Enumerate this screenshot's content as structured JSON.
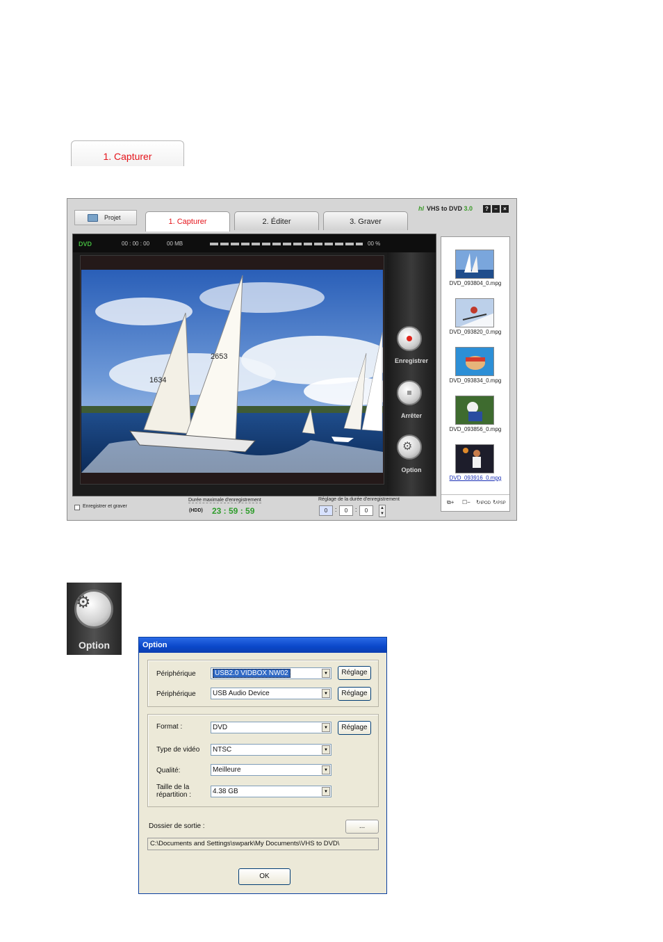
{
  "snippet_tab": {
    "label": "1. Capturer"
  },
  "app": {
    "project_label": "Projet",
    "tabs": [
      {
        "label": "1. Capturer",
        "active": true
      },
      {
        "label": "2.  Éditer",
        "active": false
      },
      {
        "label": "3. Graver",
        "active": false
      }
    ],
    "brand": {
      "logo": "hl",
      "name": "VHS to DVD",
      "version": "3.0"
    },
    "window_buttons": {
      "help": "?",
      "minimize": "–",
      "close": "×"
    },
    "status": {
      "format": "DVD",
      "time": "00 : 00 : 00",
      "size": "00 MB",
      "progress_text": "00 %"
    },
    "controls": [
      {
        "label": "Enregistrer",
        "icon": "record-icon"
      },
      {
        "label": "Arrêter",
        "icon": "stop-icon"
      },
      {
        "label": "Option",
        "icon": "gear-icon"
      }
    ],
    "bottom": {
      "burn_label": "Enregistrer et graver",
      "max_duration_label": "Durée maximale d'enregistrement",
      "hdd_label": "(HDD)",
      "max_duration_value": "23 : 59 : 59",
      "duration_setting_label": "Réglage de la durée d'enregistrement",
      "spin_values": [
        "0",
        "0",
        "0"
      ]
    },
    "thumbnails": [
      {
        "filename": "DVD_093804_0.mpg",
        "selected": false
      },
      {
        "filename": "DVD_093820_0.mpg",
        "selected": false
      },
      {
        "filename": "DVD_093834_0.mpg",
        "selected": false
      },
      {
        "filename": "DVD_093856_0.mpg",
        "selected": false
      },
      {
        "filename": "DVD_093916_0.mpg",
        "selected": true
      }
    ],
    "thumb_tools": {
      "ipod": "iPOD",
      "psp": "PSP"
    }
  },
  "option_icon": {
    "label": "Option"
  },
  "dialog": {
    "title": "Option",
    "device_video_label": "Périphérique",
    "device_video_value": "USB2.0 VIDBOX NW02",
    "device_audio_label": "Périphérique",
    "device_audio_value": "USB Audio Device",
    "setting_button": "Réglage",
    "format_label": "Format :",
    "format_value": "DVD",
    "video_type_label": "Type de vidéo",
    "video_type_value": "NTSC",
    "quality_label": "Qualité:",
    "quality_value": "Meilleure",
    "split_size_label_1": "Taille de la",
    "split_size_label_2": "répartition :",
    "split_size_value": "4.38 GB",
    "output_folder_label": "Dossier de sortie :",
    "browse_button": "...",
    "output_path": "C:\\Documents and Settings\\swpark\\My Documents\\VHS to DVD\\",
    "ok_button": "OK"
  },
  "colors": {
    "accent_red": "#e5141b",
    "timer_green": "#2e9c2b",
    "xp_title_blue": "#0a47c9"
  }
}
